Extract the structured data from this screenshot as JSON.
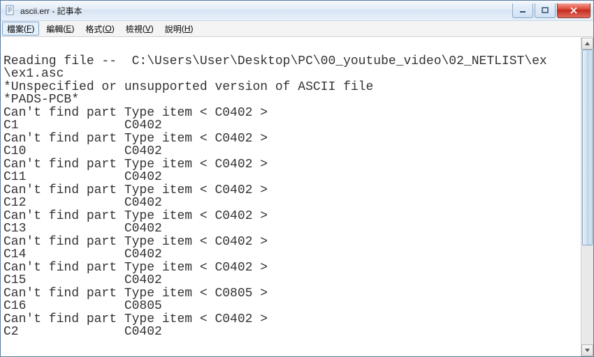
{
  "titlebar": {
    "title": "ascii.err - 記事本"
  },
  "menu": {
    "file": {
      "label": "檔案",
      "accel": "F"
    },
    "edit": {
      "label": "編輯",
      "accel": "E"
    },
    "format": {
      "label": "格式",
      "accel": "O"
    },
    "view": {
      "label": "檢視",
      "accel": "V"
    },
    "help": {
      "label": "說明",
      "accel": "H"
    }
  },
  "content": {
    "text": "\nReading file --  C:\\Users\\User\\Desktop\\PC\\00_youtube_video\\02_NETLIST\\ex\n\\ex1.asc\n*Unspecified or unsupported version of ASCII file\n*PADS-PCB*\nCan't find part Type item < C0402 >\nC1              C0402\nCan't find part Type item < C0402 >\nC10             C0402\nCan't find part Type item < C0402 >\nC11             C0402\nCan't find part Type item < C0402 >\nC12             C0402\nCan't find part Type item < C0402 >\nC13             C0402\nCan't find part Type item < C0402 >\nC14             C0402\nCan't find part Type item < C0402 >\nC15             C0402\nCan't find part Type item < C0805 >\nC16             C0805\nCan't find part Type item < C0402 >\nC2              C0402"
  }
}
